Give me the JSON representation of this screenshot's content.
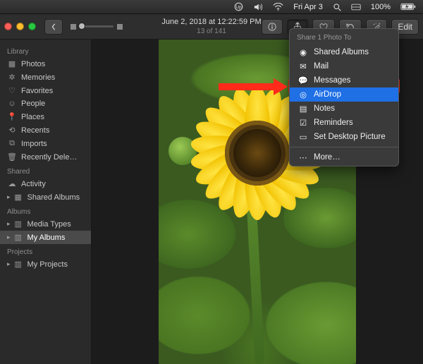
{
  "menubar": {
    "clock": "Fri Apr 3",
    "battery_pct": "100%",
    "extras": [
      "up-arrow-circle-icon",
      "volume-icon",
      "wifi-icon",
      "search-icon",
      "control-center-icon"
    ]
  },
  "toolbar": {
    "title": "June 2, 2018 at 12:22:59 PM",
    "subtitle": "13 of 141",
    "edit_label": "Edit"
  },
  "sidebar": {
    "sections": [
      {
        "header": "Library",
        "items": [
          {
            "icon": "photos-icon",
            "label": "Photos"
          },
          {
            "icon": "memories-icon",
            "label": "Memories"
          },
          {
            "icon": "heart-icon",
            "label": "Favorites"
          },
          {
            "icon": "people-icon",
            "label": "People"
          },
          {
            "icon": "places-icon",
            "label": "Places"
          },
          {
            "icon": "recents-icon",
            "label": "Recents"
          },
          {
            "icon": "imports-icon",
            "label": "Imports"
          },
          {
            "icon": "trash-icon",
            "label": "Recently Dele…"
          }
        ]
      },
      {
        "header": "Shared",
        "items": [
          {
            "icon": "cloud-icon",
            "label": "Activity"
          },
          {
            "icon": "shared-albums-icon",
            "label": "Shared Albums",
            "disclosure": true
          }
        ]
      },
      {
        "header": "Albums",
        "items": [
          {
            "icon": "folder-icon",
            "label": "Media Types",
            "disclosure": true
          },
          {
            "icon": "folder-icon",
            "label": "My Albums",
            "disclosure": true,
            "selected": true
          }
        ]
      },
      {
        "header": "Projects",
        "items": [
          {
            "icon": "folder-icon",
            "label": "My Projects",
            "disclosure": true
          }
        ]
      }
    ]
  },
  "share_menu": {
    "header": "Share 1 Photo To",
    "items": [
      {
        "icon": "shared-albums-menu-icon",
        "label": "Shared Albums",
        "color": "#3a89f5"
      },
      {
        "icon": "mail-icon",
        "label": "Mail",
        "color": "#cfd3d8"
      },
      {
        "icon": "messages-icon",
        "label": "Messages",
        "color": "#34c759"
      },
      {
        "icon": "airdrop-icon",
        "label": "AirDrop",
        "highlight": true,
        "color": "#2aa8ff"
      },
      {
        "icon": "notes-icon",
        "label": "Notes",
        "color": "#e8e7d8"
      },
      {
        "icon": "reminders-icon",
        "label": "Reminders",
        "color": "#ffffff"
      },
      {
        "icon": "desktop-picture-icon",
        "label": "Set Desktop Picture",
        "color": "#2aa8ff"
      }
    ],
    "more_label": "More…"
  }
}
